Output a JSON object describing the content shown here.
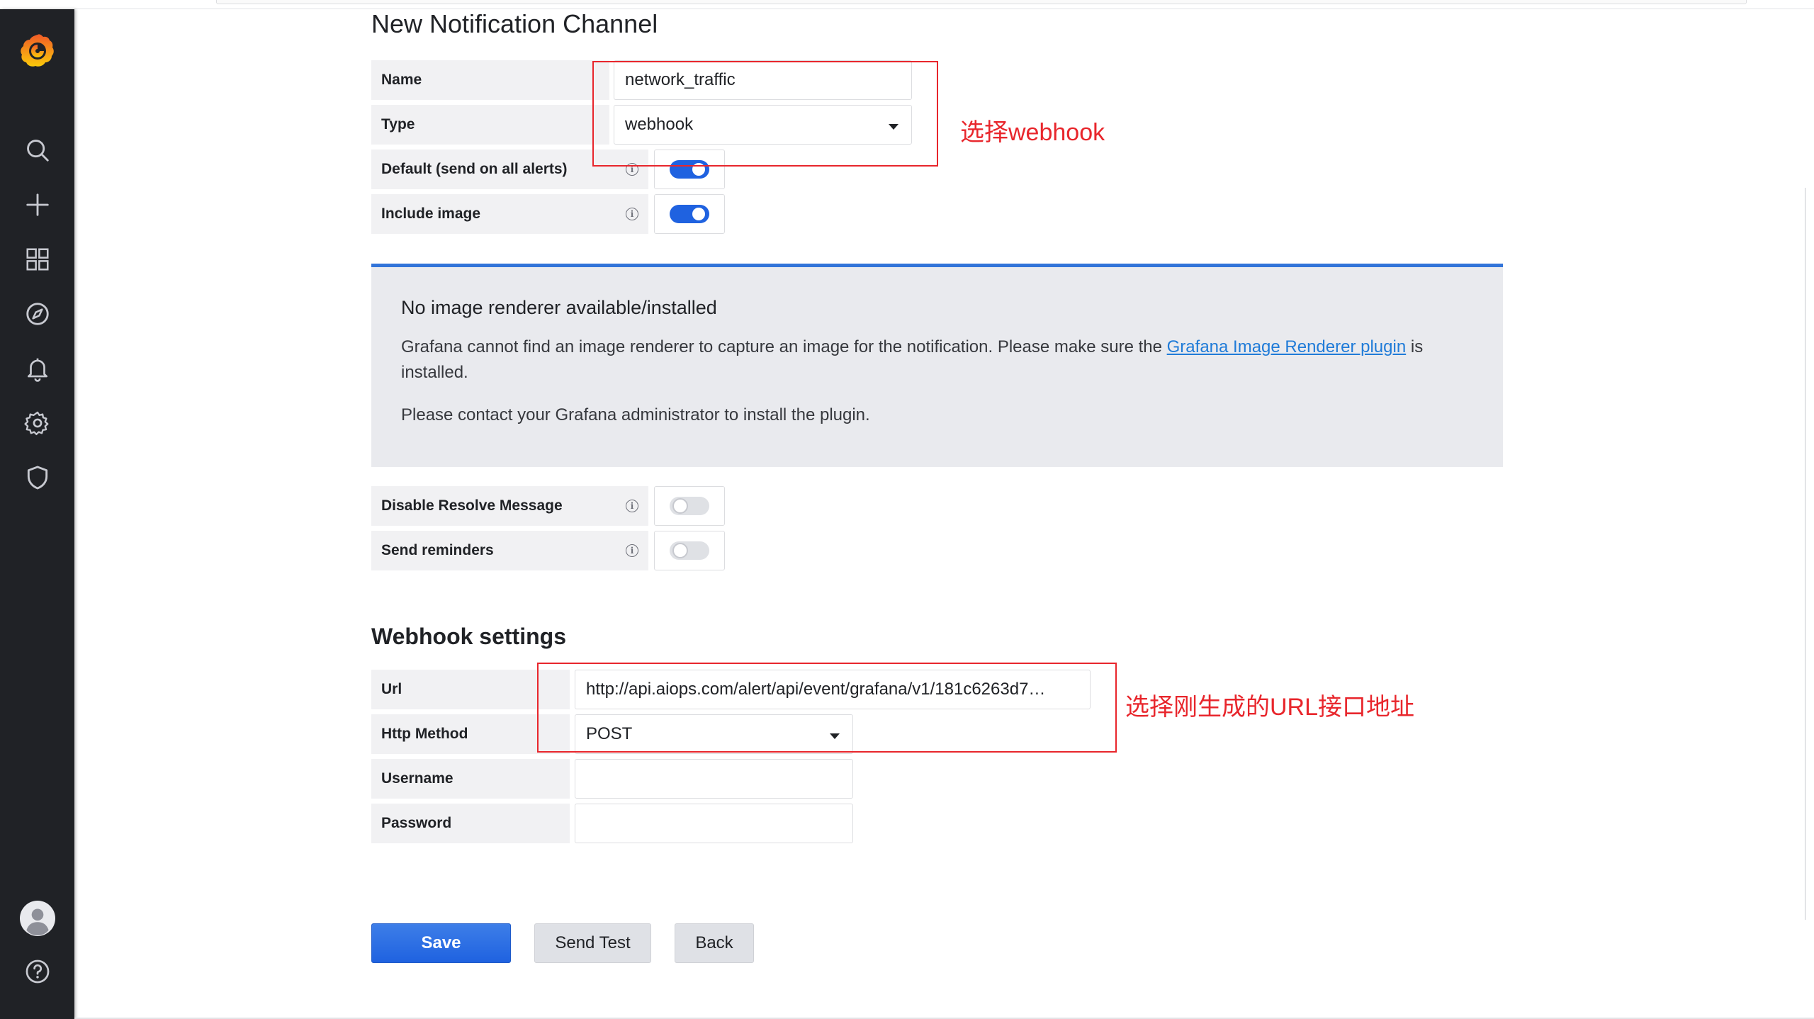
{
  "sidebar": {
    "logo": "grafana-logo",
    "items": [
      {
        "icon": "search-icon"
      },
      {
        "icon": "plus-icon"
      },
      {
        "icon": "dashboards-icon"
      },
      {
        "icon": "explore-icon"
      },
      {
        "icon": "bell-icon"
      },
      {
        "icon": "gear-icon"
      },
      {
        "icon": "shield-icon"
      }
    ],
    "bottom": [
      {
        "icon": "avatar-icon"
      },
      {
        "icon": "help-icon"
      }
    ]
  },
  "page": {
    "title": "New Notification Channel"
  },
  "form": {
    "name_label": "Name",
    "name_value": "network_traffic",
    "type_label": "Type",
    "type_value": "webhook",
    "default_label": "Default (send on all alerts)",
    "default_on": true,
    "include_image_label": "Include image",
    "include_image_on": true,
    "disable_resolve_label": "Disable Resolve Message",
    "disable_resolve_on": false,
    "send_reminders_label": "Send reminders",
    "send_reminders_on": false
  },
  "alert": {
    "title": "No image renderer available/installed",
    "text_before": "Grafana cannot find an image renderer to capture an image for the notification. Please make sure the ",
    "link_text": "Grafana Image Renderer plugin",
    "text_after": " is installed.",
    "text2": "Please contact your Grafana administrator to install the plugin."
  },
  "webhook": {
    "section_title": "Webhook settings",
    "url_label": "Url",
    "url_value": "http://api.aiops.com/alert/api/event/grafana/v1/181c6263d7…",
    "method_label": "Http Method",
    "method_value": "POST",
    "username_label": "Username",
    "username_value": "",
    "password_label": "Password",
    "password_value": ""
  },
  "buttons": {
    "save": "Save",
    "send_test": "Send Test",
    "back": "Back"
  },
  "annotations": {
    "type_note": "选择webhook",
    "url_note": "选择刚生成的URL接口地址",
    "color": "#e8262c"
  },
  "colors": {
    "accent": "#1f62e0",
    "sidebar": "#202226",
    "alert_border": "#3274d9",
    "link": "#1f7bd8"
  }
}
